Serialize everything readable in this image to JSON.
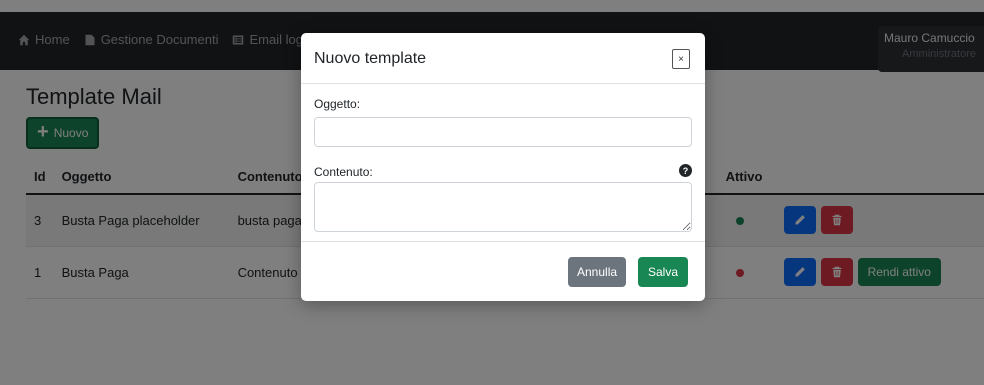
{
  "navbar": {
    "links": [
      {
        "label": "Home",
        "icon": "home-icon"
      },
      {
        "label": "Gestione Documenti",
        "icon": "document-icon"
      },
      {
        "label": "Email log",
        "icon": "list-icon"
      }
    ],
    "user_name": "Mauro Camuccio",
    "user_role": "Amministratore"
  },
  "page": {
    "title": "Template Mail",
    "new_button_label": "Nuovo"
  },
  "table": {
    "headers": [
      "Id",
      "Oggetto",
      "Contenuto",
      "Attivo"
    ],
    "rows": [
      {
        "id": "3",
        "oggetto": "Busta Paga placeholder",
        "contenuto": "busta paga",
        "active": false,
        "status_color": "#198754"
      },
      {
        "id": "1",
        "oggetto": "Busta Paga",
        "contenuto": "Contenuto",
        "active": true,
        "status_color": "#dc3545",
        "activate_label": "Rendi attivo"
      }
    ]
  },
  "modal": {
    "title": "Nuovo template",
    "close_symbol": "×",
    "oggetto_label": "Oggetto:",
    "oggetto_value": "",
    "contenuto_label": "Contenuto:",
    "contenuto_value": "",
    "help_symbol": "?",
    "cancel_label": "Annulla",
    "save_label": "Salva"
  },
  "colors": {
    "primary": "#0d6efd",
    "success": "#198754",
    "danger": "#dc3545",
    "secondary": "#6c757d",
    "navbar": "#212529"
  }
}
